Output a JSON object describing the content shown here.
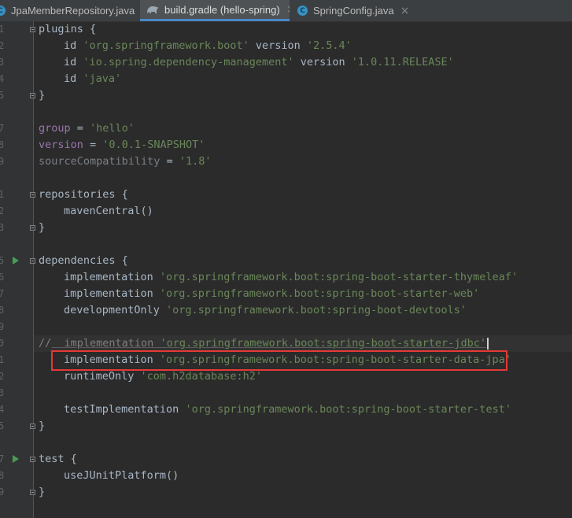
{
  "tabs": [
    {
      "label": "JpaMemberRepository.java",
      "icon": "java-class-icon",
      "active": false
    },
    {
      "label": "build.gradle (hello-spring)",
      "icon": "gradle-elephant-icon",
      "active": true
    },
    {
      "label": "SpringConfig.java",
      "icon": "java-class-icon",
      "active": false
    }
  ],
  "close_glyph": "×",
  "gutter": {
    "line_numbers": [
      "1",
      "2",
      "3",
      "4",
      "5",
      "",
      "7",
      "8",
      "9",
      "",
      "1",
      "2",
      "3",
      "",
      "5",
      "6",
      "7",
      "8",
      "9",
      "0",
      "1",
      "2",
      "3",
      "4",
      "5",
      "",
      "7",
      "8",
      "9",
      ""
    ]
  },
  "code": {
    "l1_kw": "plugins",
    "l1_brace": " {",
    "l2_id": "id ",
    "l2_str": "'org.springframework.boot'",
    "l2_ver": " version ",
    "l2_verstr": "'2.5.4'",
    "l3_id": "id ",
    "l3_str": "'io.spring.dependency-management'",
    "l3_ver": " version ",
    "l3_verstr": "'1.0.11.RELEASE'",
    "l4_id": "id ",
    "l4_str": "'java'",
    "l5": "}",
    "l7_prop": "group",
    "l7_eq": " = ",
    "l7_str": "'hello'",
    "l8_prop": "version",
    "l8_eq": " = ",
    "l8_str": "'0.0.1-SNAPSHOT'",
    "l9_prop": "sourceCompatibility",
    "l9_eq": " = ",
    "l9_str": "'1.8'",
    "l11_kw": "repositories",
    "l11_brace": " {",
    "l12": "mavenCentral()",
    "l13": "}",
    "l15_kw": "dependencies",
    "l15_brace": " {",
    "l16_kw": "implementation ",
    "l16_str": "'org.springframework.boot:spring-boot-starter-thymeleaf'",
    "l17_kw": "implementation ",
    "l17_str": "'org.springframework.boot:spring-boot-starter-web'",
    "l18_kw": "developmentOnly ",
    "l18_str": "'org.springframework.boot:spring-boot-devtools'",
    "l20_slash": "//",
    "l20_kw": "  implementation ",
    "l20_str": "'org.springframework.boot:spring-boot-starter-jdbc'",
    "l21_kw": "implementation ",
    "l21_str": "'org.springframework.boot:spring-boot-starter-data-jpa'",
    "l22_kw": "runtimeOnly ",
    "l22_str": "'com.h2database:h2'",
    "l24_kw": "testImplementation ",
    "l24_str": "'org.springframework.boot:spring-boot-starter-test'",
    "l25": "}",
    "l27_kw": "test",
    "l27_brace": " {",
    "l28": "useJUnitPlatform()",
    "l29": "}"
  },
  "colors": {
    "background": "#2b2b2b",
    "string": "#6a8759",
    "property": "#9876aa",
    "highlight_box": "#e53935",
    "active_tab_underline": "#4a88c7"
  }
}
